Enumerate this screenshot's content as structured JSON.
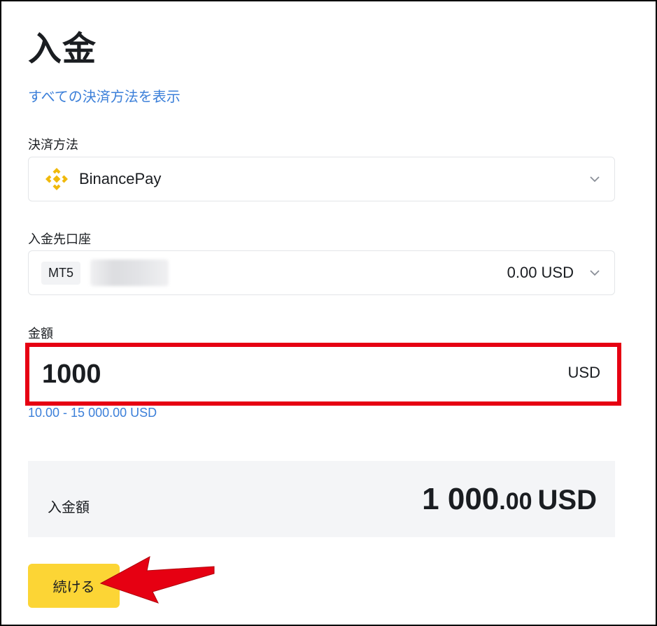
{
  "page": {
    "title": "入金",
    "all_methods_link": "すべての決済方法を表示"
  },
  "payment_method": {
    "label": "決済方法",
    "selected": "BinancePay",
    "icon": "binance-logo-icon"
  },
  "account": {
    "label": "入金先口座",
    "platform": "MT5",
    "balance": "0.00 USD"
  },
  "amount": {
    "label": "金額",
    "value": "1000",
    "currency": "USD",
    "range": "10.00 - 15 000.00 USD"
  },
  "summary": {
    "label": "入金額",
    "amount_integer": "1 000",
    "amount_decimal": ".00",
    "currency": "USD"
  },
  "actions": {
    "continue_label": "続ける"
  },
  "colors": {
    "accent_yellow": "#fcd535",
    "link_blue": "#3b7fd9",
    "highlight_red": "#e60012",
    "binance_gold": "#f0b90b"
  }
}
